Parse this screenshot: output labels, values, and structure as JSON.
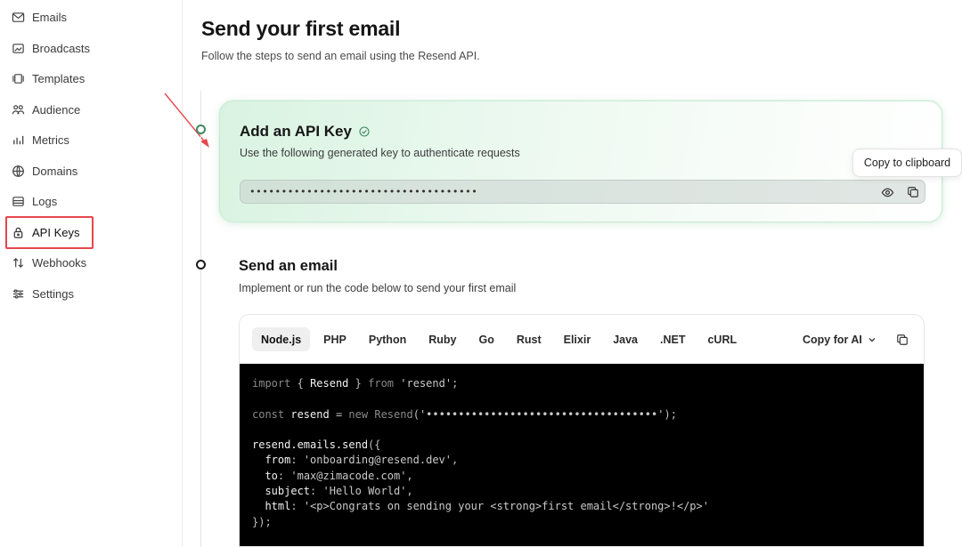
{
  "sidebar": {
    "items": [
      {
        "label": "Emails",
        "icon": "mail-icon"
      },
      {
        "label": "Broadcasts",
        "icon": "broadcast-icon"
      },
      {
        "label": "Templates",
        "icon": "templates-icon"
      },
      {
        "label": "Audience",
        "icon": "users-icon"
      },
      {
        "label": "Metrics",
        "icon": "bar-chart-icon"
      },
      {
        "label": "Domains",
        "icon": "globe-icon"
      },
      {
        "label": "Logs",
        "icon": "logs-icon"
      },
      {
        "label": "API Keys",
        "icon": "lock-icon"
      },
      {
        "label": "Webhooks",
        "icon": "webhook-icon"
      },
      {
        "label": "Settings",
        "icon": "settings-icon"
      }
    ],
    "active": "API Keys"
  },
  "main": {
    "title": "Send your first email",
    "subtitle": "Follow the steps to send an email using the Resend API.",
    "step1": {
      "title": "Add an API Key",
      "description": "Use the following generated key to authenticate requests",
      "key_masked": "••••••••••••••••••••••••••••••••••••"
    },
    "tooltip": "Copy to clipboard",
    "step2": {
      "title": "Send an email",
      "description": "Implement or run the code below to send your first email",
      "tabs": [
        "Node.js",
        "PHP",
        "Python",
        "Ruby",
        "Go",
        "Rust",
        "Elixir",
        "Java",
        ".NET",
        "cURL"
      ],
      "active_tab": "Node.js",
      "copy_for_ai": "Copy for AI"
    },
    "code": {
      "line1_kw": "import",
      "line1_id": "Resend",
      "line1_from": "from",
      "line1_str": "'resend'",
      "line2_kw": "const",
      "line2_id": "resend",
      "line2_new": "new",
      "line2_cls": "Resend",
      "line2_key": "'••••••••••••••••••••••••••••••••••••'",
      "line3": "resend.emails.send",
      "from_key": "from",
      "from_val": "'onboarding@resend.dev'",
      "to_key": "to",
      "to_val": "'max@zimacode.com'",
      "subject_key": "subject",
      "subject_val": "'Hello World'",
      "html_key": "html",
      "html_val": "'<p>Congrats on sending your <strong>first email</strong>!</p>'",
      "close": "});"
    }
  },
  "colors": {
    "annotation": "#e5474d",
    "success": "#3d8a5e",
    "card_bg": "#d9f3e1"
  }
}
